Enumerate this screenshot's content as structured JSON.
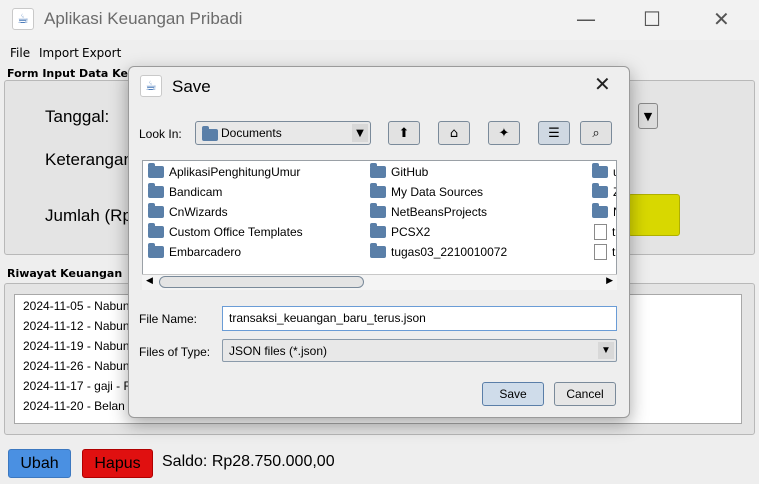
{
  "window": {
    "title": "Aplikasi Keuangan Pribadi",
    "minimize": "—",
    "maximize": "☐",
    "close": "✕"
  },
  "menu": [
    "File",
    "Import",
    "Export"
  ],
  "form": {
    "panel_title": "Form Input Data Keua",
    "tanggal_label": "Tanggal:",
    "keterangan_label": "Keterangan",
    "jumlah_label": "Jumlah (Rp"
  },
  "history": {
    "panel_title": "Riwayat Keuangan",
    "rows": [
      "2024-11-05 - Nabun",
      "2024-11-12 - Nabun",
      "2024-11-19 - Nabun",
      "2024-11-26 - Nabun",
      "2024-11-17 - gaji - F",
      "2024-11-20 - Belan"
    ]
  },
  "footer": {
    "ubah": "Ubah",
    "hapus": "Hapus",
    "saldo": "Saldo: Rp28.750.000,00"
  },
  "dialog": {
    "title": "Save",
    "look_in_label": "Look In:",
    "look_in_value": "Documents",
    "files_col1": [
      {
        "name": "AplikasiPenghitungUmur",
        "type": "folder"
      },
      {
        "name": "Bandicam",
        "type": "folder"
      },
      {
        "name": "CnWizards",
        "type": "folder"
      },
      {
        "name": "Custom Office Templates",
        "type": "folder"
      },
      {
        "name": "Embarcadero",
        "type": "folder"
      }
    ],
    "files_col2": [
      {
        "name": "GitHub",
        "type": "folder"
      },
      {
        "name": "My Data Sources",
        "type": "folder"
      },
      {
        "name": "NetBeansProjects",
        "type": "folder"
      },
      {
        "name": "PCSX2",
        "type": "folder"
      },
      {
        "name": "tugas03_2210010072",
        "type": "folder"
      }
    ],
    "files_col3": [
      {
        "name": "u",
        "type": "folder"
      },
      {
        "name": "Z",
        "type": "folder"
      },
      {
        "name": "N",
        "type": "folder"
      },
      {
        "name": "tr",
        "type": "file"
      },
      {
        "name": "tr",
        "type": "file"
      }
    ],
    "file_name_label": "File Name:",
    "file_name_value": "transaksi_keuangan_baru_terus.json",
    "files_of_type_label": "Files of Type:",
    "files_of_type_value": "JSON files (*.json)",
    "save_button": "Save",
    "cancel_button": "Cancel"
  },
  "colors": {
    "ubah_button": "#4a90e2",
    "hapus_button": "#e01010",
    "yellow_button": "#d8d800"
  }
}
